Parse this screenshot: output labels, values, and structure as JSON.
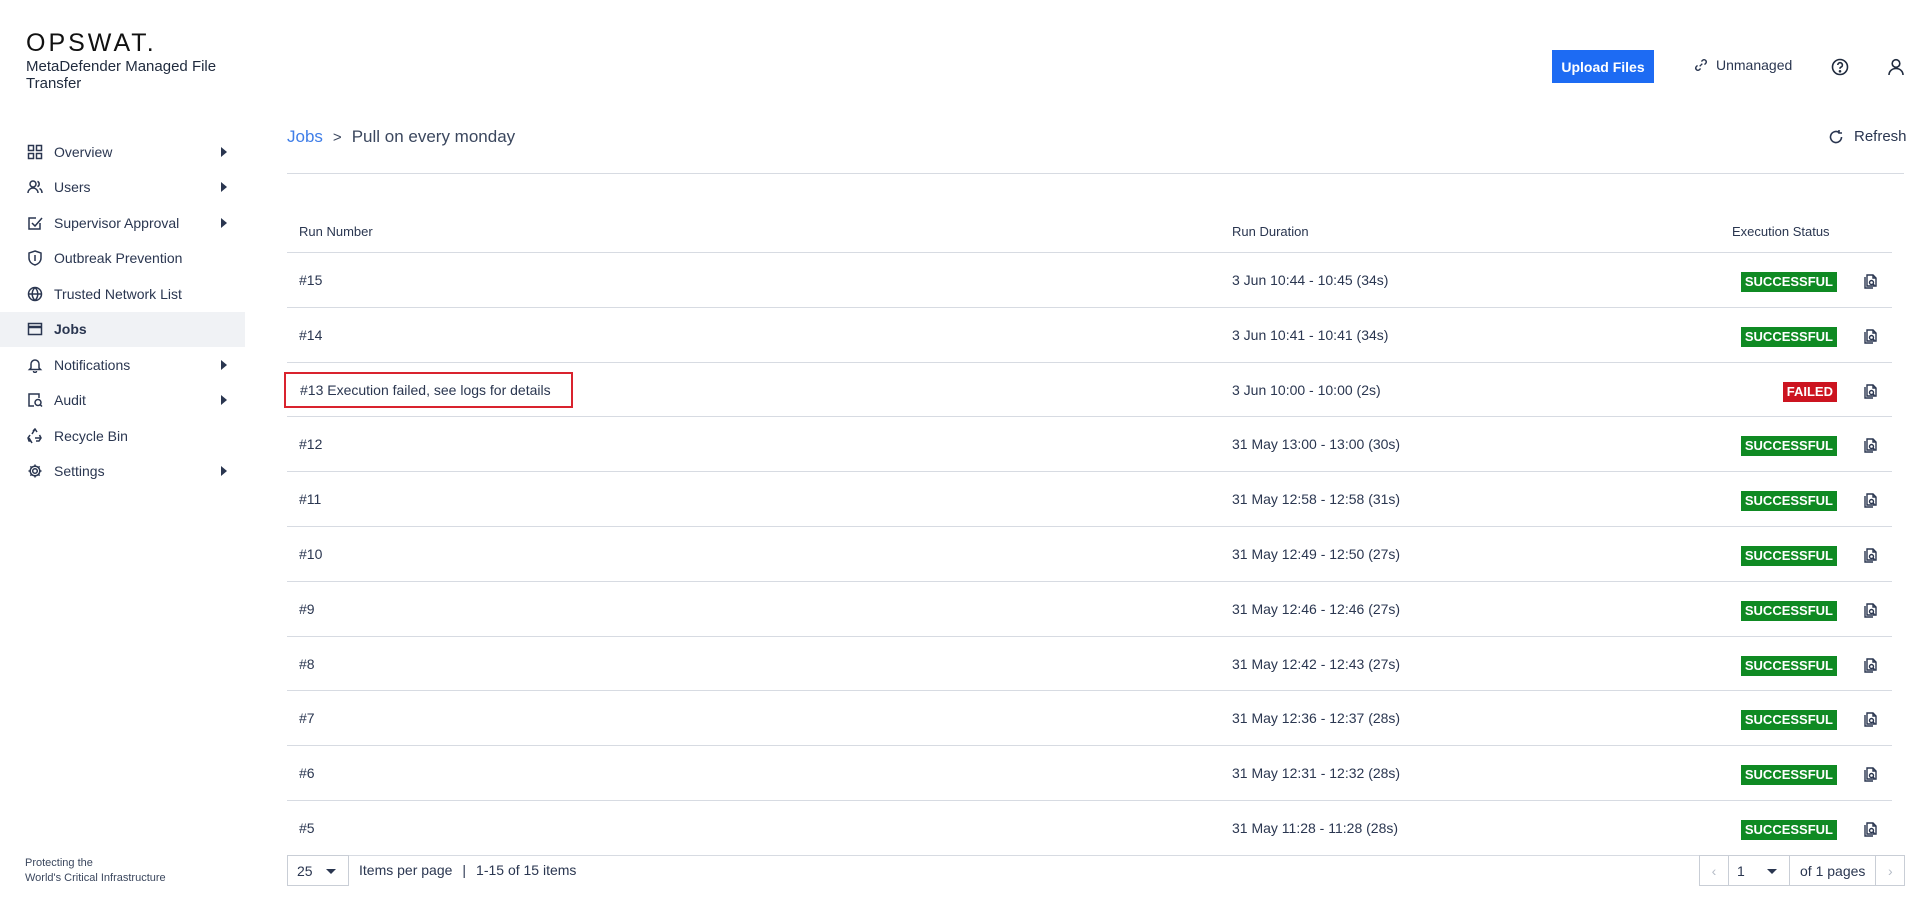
{
  "brand": {
    "logo": "OPSWAT.",
    "product": "MetaDefender Managed File Transfer",
    "footer_line1": "Protecting the",
    "footer_line2": "World's Critical Infrastructure"
  },
  "sidebar": {
    "items": [
      {
        "label": "Overview",
        "icon": "grid-icon",
        "arrow": true
      },
      {
        "label": "Users",
        "icon": "users-icon",
        "arrow": true
      },
      {
        "label": "Supervisor Approval",
        "icon": "checkbox-icon",
        "arrow": true
      },
      {
        "label": "Outbreak Prevention",
        "icon": "shield-icon",
        "arrow": false
      },
      {
        "label": "Trusted Network List",
        "icon": "globe-icon",
        "arrow": false
      },
      {
        "label": "Jobs",
        "icon": "window-icon",
        "arrow": false,
        "active": true
      },
      {
        "label": "Notifications",
        "icon": "bell-icon",
        "arrow": true
      },
      {
        "label": "Audit",
        "icon": "audit-icon",
        "arrow": true
      },
      {
        "label": "Recycle Bin",
        "icon": "recycle-icon",
        "arrow": false
      },
      {
        "label": "Settings",
        "icon": "gear-icon",
        "arrow": true
      }
    ]
  },
  "header": {
    "upload_label": "Upload Files",
    "unmanaged_label": "Unmanaged"
  },
  "breadcrumb": {
    "parent": "Jobs",
    "current": "Pull on every monday"
  },
  "refresh_label": "Refresh",
  "table": {
    "columns": {
      "run": "Run Number",
      "duration": "Run Duration",
      "status": "Execution Status"
    },
    "rows": [
      {
        "run": "#15",
        "duration": "3 Jun 10:44 - 10:45 (34s)",
        "status": "SUCCESSFUL",
        "ok": true
      },
      {
        "run": "#14",
        "duration": "3 Jun 10:41 - 10:41 (34s)",
        "status": "SUCCESSFUL",
        "ok": true
      },
      {
        "run": "#13 Execution failed, see logs for details",
        "duration": "3 Jun 10:00 - 10:00 (2s)",
        "status": "FAILED",
        "ok": false,
        "highlight": true
      },
      {
        "run": "#12",
        "duration": "31 May 13:00 - 13:00 (30s)",
        "status": "SUCCESSFUL",
        "ok": true
      },
      {
        "run": "#11",
        "duration": "31 May 12:58 - 12:58 (31s)",
        "status": "SUCCESSFUL",
        "ok": true
      },
      {
        "run": "#10",
        "duration": "31 May 12:49 - 12:50 (27s)",
        "status": "SUCCESSFUL",
        "ok": true
      },
      {
        "run": "#9",
        "duration": "31 May 12:46 - 12:46 (27s)",
        "status": "SUCCESSFUL",
        "ok": true
      },
      {
        "run": "#8",
        "duration": "31 May 12:42 - 12:43 (27s)",
        "status": "SUCCESSFUL",
        "ok": true
      },
      {
        "run": "#7",
        "duration": "31 May 12:36 - 12:37 (28s)",
        "status": "SUCCESSFUL",
        "ok": true
      },
      {
        "run": "#6",
        "duration": "31 May 12:31 - 12:32 (28s)",
        "status": "SUCCESSFUL",
        "ok": true
      },
      {
        "run": "#5",
        "duration": "31 May 11:28 - 11:28 (28s)",
        "status": "SUCCESSFUL",
        "ok": true
      }
    ]
  },
  "pagination": {
    "per_page": "25",
    "per_page_label": "Items per page",
    "separator": "|",
    "range": "1-15 of 15 items",
    "page": "1",
    "of_pages": "of 1 pages",
    "prev": "‹",
    "next": "›"
  },
  "colors": {
    "accent": "#1d6bf3",
    "success": "#0f8a23",
    "failed": "#cc1420",
    "highlight_border": "#d9232e"
  }
}
